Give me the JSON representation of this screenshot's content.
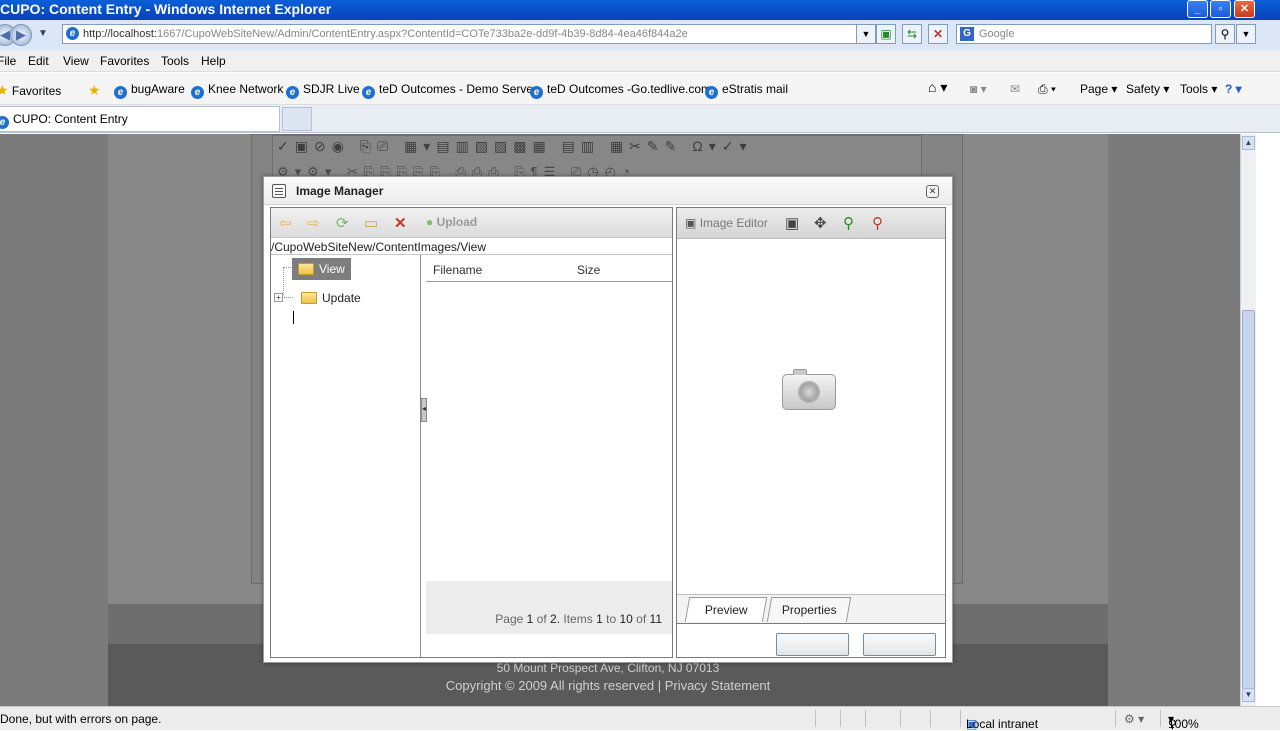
{
  "window": {
    "title": "CUPO: Content Entry - Windows Internet Explorer"
  },
  "address": {
    "url_host": "http://localhost:",
    "url_rest": "1667/CupoWebSiteNew/Admin/ContentEntry.aspx?ContentId=COTe733ba2e-dd9f-4b39-8d84-4ea46f844a2e",
    "search_placeholder": "Google"
  },
  "menu": {
    "items": [
      "File",
      "Edit",
      "View",
      "Favorites",
      "Tools",
      "Help"
    ]
  },
  "favorites": {
    "label": "Favorites",
    "links": [
      "bugAware",
      "Knee Network",
      "SDJR Live",
      "teD Outcomes - Demo Server",
      "teD Outcomes -Go.tedlive.com",
      "eStratis mail"
    ],
    "commands": {
      "page": "Page",
      "safety": "Safety",
      "tools": "Tools"
    }
  },
  "tab": {
    "label": "CUPO: Content Entry"
  },
  "footer": {
    "address": "50 Mount Prospect Ave, Clifton, NJ 07013",
    "copyright": "Copyright © 2009 All rights reserved | Privacy Statement"
  },
  "dialog": {
    "title": "Image Manager",
    "upload_label": "Upload",
    "path": "/CupoWebSiteNew/ContentImages/View",
    "tree": {
      "items": [
        {
          "label": "View",
          "selected": true
        },
        {
          "label": "Update",
          "selected": false
        }
      ]
    },
    "filelist": {
      "columns": [
        "Filename",
        "Size"
      ]
    },
    "pager": {
      "prefix": "Page",
      "page": "1",
      "of_label": "of",
      "pages": "2.",
      "items_label": "Items",
      "from": "1",
      "to_label": "to",
      "to": "10",
      "of2_label": "of",
      "total": "11"
    },
    "preview": {
      "image_editor_label": "Image Editor",
      "tabs": [
        "Preview",
        "Properties"
      ]
    }
  },
  "statusbar": {
    "status": "Done, but with errors on page.",
    "zone": "Local intranet",
    "zoom": "100%"
  }
}
